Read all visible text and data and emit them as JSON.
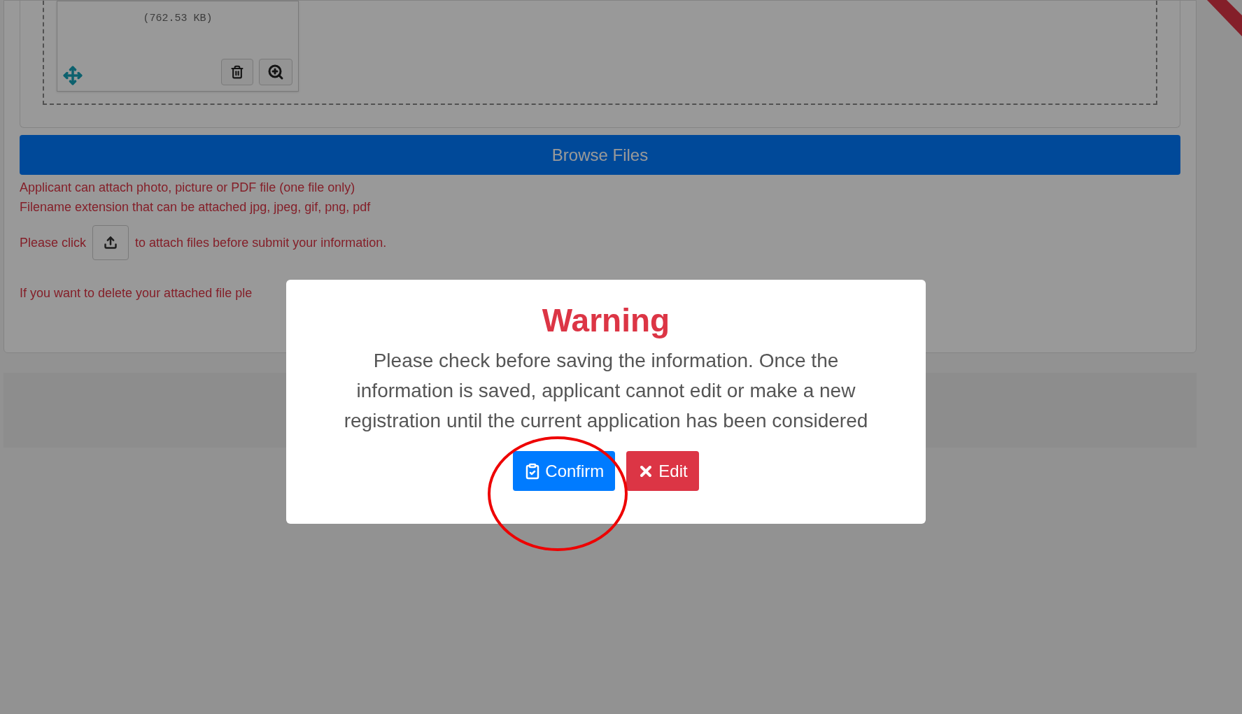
{
  "file_card": {
    "size": "(762.53 KB)"
  },
  "browse_button": "Browse Files",
  "notes": [
    "Applicant can attach photo, picture or PDF file (one file only)",
    "Filename extension that can be attached jpg, jpeg, gif, png, pdf"
  ],
  "instruction": {
    "before": "Please click",
    "after": "to attach files before submit your information."
  },
  "delete_note": "If you want to delete your attached file ple",
  "modal": {
    "title": "Warning",
    "message_lines": [
      "Please check before saving the information. Once the",
      "information is saved, applicant cannot edit or make a new",
      "registration until the current application has been considered"
    ],
    "buttons": [
      {
        "kind": "confirm",
        "label": "Confirm"
      },
      {
        "kind": "edit",
        "label": "Edit"
      }
    ]
  }
}
